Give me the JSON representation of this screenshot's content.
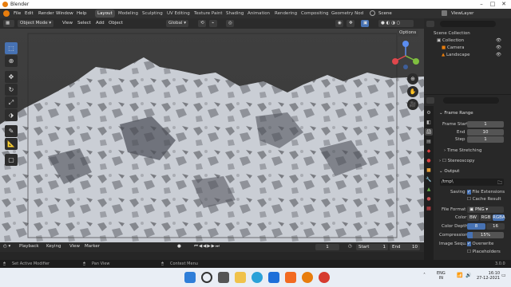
{
  "app": {
    "title": "Blender"
  },
  "menu": [
    "File",
    "Edit",
    "Render",
    "Window",
    "Help"
  ],
  "workspaces": [
    "Layout",
    "Modeling",
    "Sculpting",
    "UV Editing",
    "Texture Paint",
    "Shading",
    "Animation",
    "Rendering",
    "Compositing",
    "Geometry Nod"
  ],
  "scene": {
    "label": "Scene",
    "view_layer": "ViewLayer"
  },
  "viewport_header": {
    "mode": "Object Mode",
    "view": "View",
    "select": "Select",
    "add": "Add",
    "object": "Object",
    "transform": "Global",
    "options": "Options"
  },
  "outliner": {
    "items": [
      "Scene Collection",
      "Collection",
      "Camera",
      "Landscape"
    ]
  },
  "properties": {
    "frame_range": {
      "title": "Frame Range",
      "start_label": "Frame Start",
      "start": "1",
      "end_label": "End",
      "end": "10",
      "step_label": "Step",
      "step": "1"
    },
    "time_stretching": "Time Stretching",
    "stereoscopy": "Stereoscopy",
    "output": {
      "title": "Output",
      "path": "/tmp\\",
      "saving_label": "Saving",
      "file_extensions": "File Extensions",
      "cache_result": "Cache Result",
      "file_format_label": "File Format",
      "file_format": "PNG",
      "color_label": "Color",
      "color_options": [
        "BW",
        "RGB",
        "RGBA"
      ],
      "color_depth_label": "Color Depth",
      "depth_options": [
        "8",
        "16"
      ],
      "compression_label": "Compression",
      "compression": "15%",
      "image_seq_label": "Image Sequ...",
      "overwrite": "Overwrite",
      "placeholders": "Placeholders"
    }
  },
  "timeline": {
    "playback": "Playback",
    "keying": "Keying",
    "view": "View",
    "marker": "Marker",
    "current_frame": "1",
    "start_label": "Start",
    "start": "1",
    "end_label": "End",
    "end": "10"
  },
  "status": {
    "left": "Set Active Modifier",
    "mid": "Pan View",
    "right": "Context Menu",
    "version": "3.0.0"
  },
  "taskbar": {
    "lang": "ENG",
    "region": "IN",
    "time": "16:10",
    "date": "27-12-2021"
  },
  "colors": {
    "accent": "#4772b3",
    "blender_orange": "#e87d0d"
  }
}
